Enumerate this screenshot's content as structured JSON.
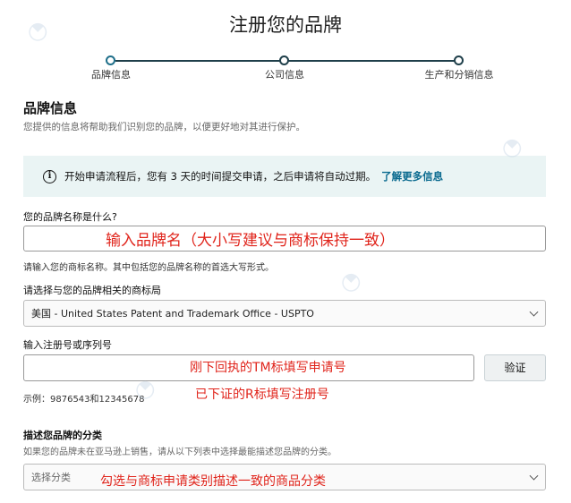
{
  "page": {
    "title": "注册您的品牌"
  },
  "stepper": {
    "steps": [
      {
        "label": "品牌信息",
        "active": true
      },
      {
        "label": "公司信息",
        "active": false
      },
      {
        "label": "生产和分销信息",
        "active": false
      }
    ]
  },
  "brand_info": {
    "heading": "品牌信息",
    "description": "您提供的信息将帮助我们识别您的品牌，以便更好地对其进行保护。"
  },
  "alert": {
    "icon": "info-icon",
    "text": "开始申请流程后，您有 3 天的时间提交申请，之后申请将自动过期。",
    "link": "了解更多信息"
  },
  "brand_name": {
    "label": "您的品牌名称是什么?",
    "value": "",
    "helper": "请输入您的商标名称。其中包括您的品牌名称的首选大写形式。",
    "annotation": "输入品牌名（大小写建议与商标保持一致）"
  },
  "trademark_office": {
    "label": "请选择与您的品牌相关的商标局",
    "selected": "美国 - United States Patent and Trademark Office - USPTO"
  },
  "registration": {
    "label": "输入注册号或序列号",
    "value": "",
    "verify_button": "验证",
    "example": "示例：9876543和12345678",
    "annotation_1": "刚下回执的TM标填写申请号",
    "annotation_2": "已下证的R标填写注册号"
  },
  "category": {
    "label": "描述您品牌的分类",
    "description": "如果您的品牌未在亚马逊上销售，请从以下列表中选择最能描述您品牌的分类。",
    "placeholder": "选择分类",
    "annotation": "勾选与商标申请类别描述一致的商品分类"
  },
  "colors": {
    "annotation": "#e0241b",
    "link": "#0a6a8f",
    "alert_bg": "#eaf4f4",
    "stepper": "#1f3f4a"
  }
}
